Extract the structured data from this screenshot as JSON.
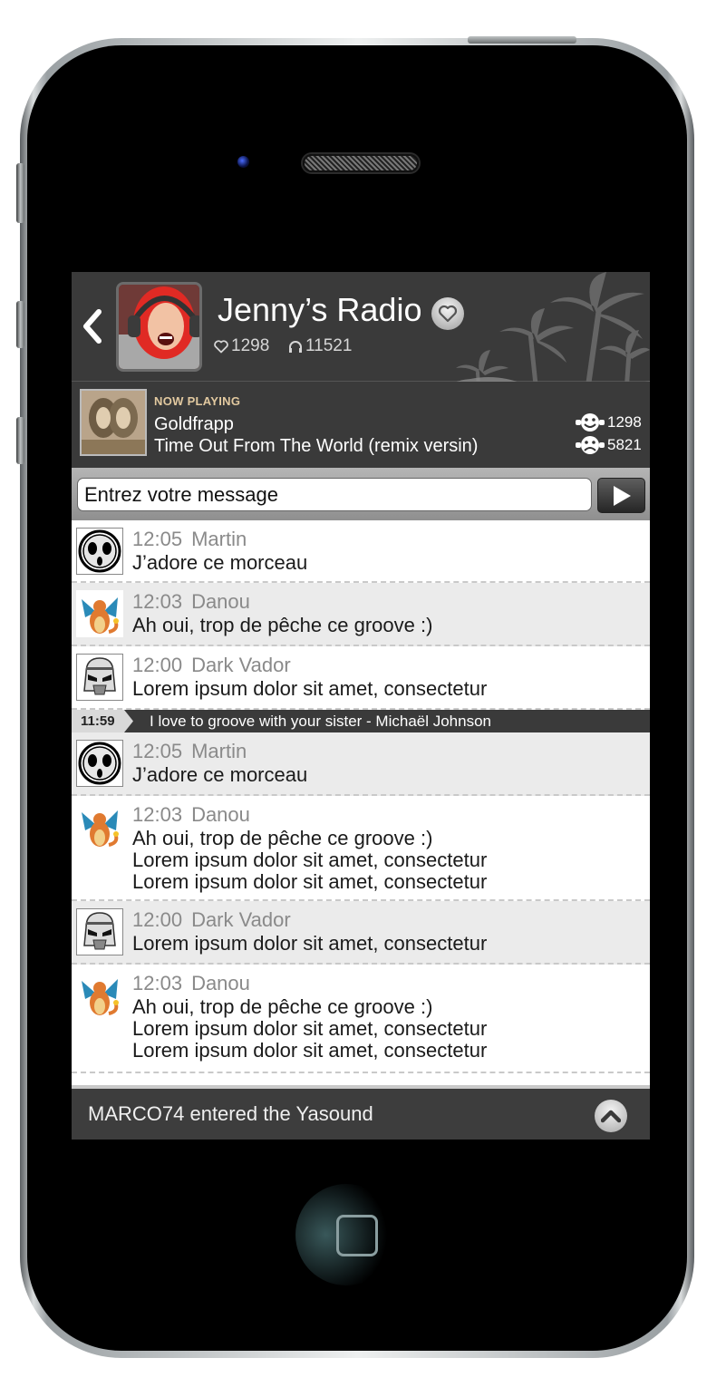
{
  "header": {
    "back_icon": "back-chevron-icon",
    "radio_title": "Jenny’s Radio",
    "favorite_icon": "heart-icon",
    "likes_count": "1298",
    "listeners_count": "11521"
  },
  "now_playing": {
    "label": "NOW PLAYING",
    "artist": "Goldfrapp",
    "track": "Time Out From The World (remix versin)",
    "album_text": "Goldfrapp",
    "likes": "1298",
    "dislikes": "5821"
  },
  "composer": {
    "placeholder": "Entrez votre message",
    "send_icon": "play-triangle-icon"
  },
  "messages": [
    {
      "time": "12:05",
      "author": "Martin",
      "avatar": "ghost-mask-avatar",
      "lines": [
        "J’adore ce morceau"
      ]
    },
    {
      "time": "12:03",
      "author": "Danou",
      "avatar": "dragon-avatar",
      "lines": [
        "Ah oui, trop de pêche ce groove :)"
      ]
    },
    {
      "time": "12:00",
      "author": "Dark Vador",
      "avatar": "stormtrooper-avatar",
      "lines": [
        "Lorem ipsum dolor sit amet, consectetur"
      ]
    },
    {
      "time": "12:05",
      "author": "Martin",
      "avatar": "ghost-mask-avatar",
      "lines": [
        "J’adore ce morceau"
      ]
    },
    {
      "time": "12:03",
      "author": "Danou",
      "avatar": "dragon-avatar",
      "lines": [
        "Ah oui, trop de pêche ce groove :)",
        "Lorem ipsum dolor sit amet, consectetur",
        "Lorem ipsum dolor sit amet, consectetur"
      ]
    },
    {
      "time": "12:00",
      "author": "Dark Vador",
      "avatar": "stormtrooper-avatar",
      "lines": [
        "Lorem ipsum dolor sit amet, consectetur"
      ]
    },
    {
      "time": "12:03",
      "author": "Danou",
      "avatar": "dragon-avatar",
      "lines": [
        "Ah oui, trop de pêche ce groove :)",
        "Lorem ipsum dolor sit amet, consectetur",
        "Lorem ipsum dolor sit amet, consectetur"
      ]
    }
  ],
  "song_separator": {
    "time": "11:59",
    "text": "I love to groove with your sister - Michaël Johnson"
  },
  "footer": {
    "text": "MARCO74 entered the Yasound",
    "button_icon": "chevron-up-icon"
  },
  "colors": {
    "header_bg": "#3a3a3a",
    "now_playing_label": "#e2c9a0",
    "row_alt": "#ebebeb",
    "meta_text": "#8a8a8a"
  }
}
